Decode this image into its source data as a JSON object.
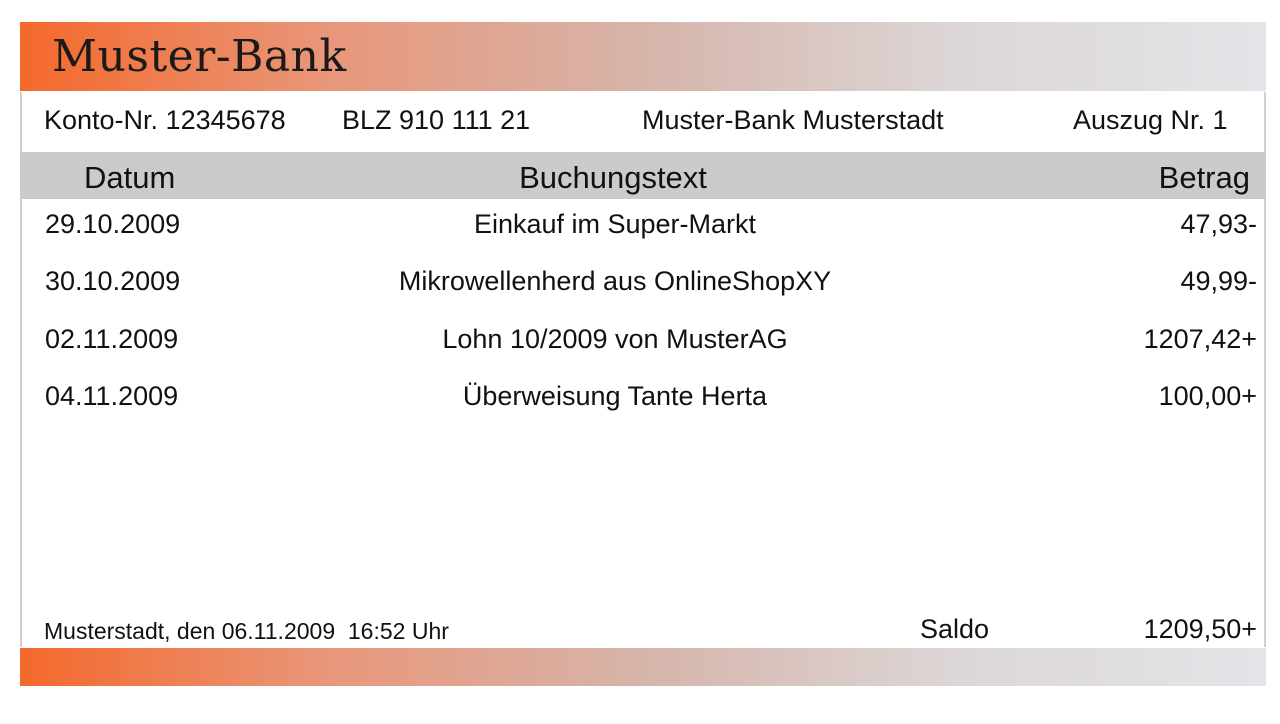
{
  "header": {
    "bank_name": "Muster-Bank"
  },
  "info": {
    "konto": "Konto-Nr. 12345678",
    "blz": "BLZ 910 111 21",
    "bank_ort": "Muster-Bank Musterstadt",
    "auszug": "Auszug Nr. 1"
  },
  "table": {
    "columns": [
      "Datum",
      "Buchungstext",
      "Betrag"
    ],
    "rows": [
      {
        "date": "29.10.2009",
        "text": "Einkauf im Super-Markt",
        "amount": "47,93-"
      },
      {
        "date": "30.10.2009",
        "text": "Mikrowellenherd aus OnlineShopXY",
        "amount": "49,99-"
      },
      {
        "date": "02.11.2009",
        "text": "Lohn 10/2009 von MusterAG",
        "amount": "1207,42+"
      },
      {
        "date": "04.11.2009",
        "text": "Überweisung Tante Herta",
        "amount": "100,00+"
      }
    ]
  },
  "footer": {
    "place_date": "Musterstadt, den 06.11.2009  16:52 Uhr",
    "saldo_label": "Saldo",
    "saldo_amount": "1209,50+"
  },
  "colors": {
    "accent_orange": "#f4692c",
    "header_gray": "#cbcbcb"
  }
}
